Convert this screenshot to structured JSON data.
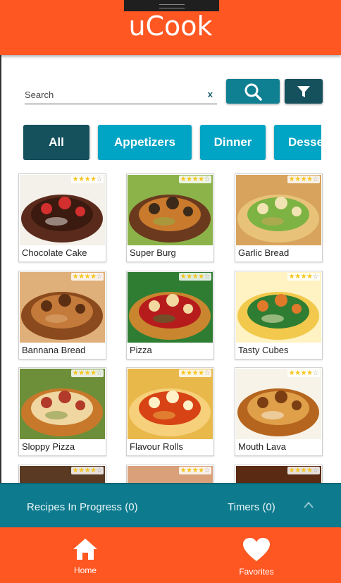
{
  "app": {
    "title": "uCook"
  },
  "search": {
    "placeholder": "Search",
    "value": "",
    "clear_label": "x"
  },
  "categories": [
    {
      "label": "All",
      "active": true
    },
    {
      "label": "Appetizers",
      "active": false
    },
    {
      "label": "Dinner",
      "active": false
    },
    {
      "label": "Desse",
      "active": false
    }
  ],
  "recipes": [
    {
      "name": "Chocolate Cake",
      "rating": 4,
      "icon": "chocolate-cake-photo"
    },
    {
      "name": "Super Burg",
      "rating": 4,
      "icon": "burger-photo"
    },
    {
      "name": "Garlic Bread",
      "rating": 4,
      "icon": "garlic-bread-photo"
    },
    {
      "name": "Bannana Bread",
      "rating": 4,
      "icon": "banana-bread-photo"
    },
    {
      "name": "Pizza",
      "rating": 4,
      "icon": "pizza-photo"
    },
    {
      "name": "Tasty Cubes",
      "rating": 4,
      "icon": "cubes-photo"
    },
    {
      "name": "Sloppy Pizza",
      "rating": 4,
      "icon": "calzone-photo"
    },
    {
      "name": "Flavour Rolls",
      "rating": 4,
      "icon": "rolls-photo"
    },
    {
      "name": "Mouth Lava",
      "rating": 4,
      "icon": "mozzarella-sticks-photo"
    },
    {
      "name": "",
      "rating": 4,
      "icon": "recipe-photo"
    },
    {
      "name": "",
      "rating": 4,
      "icon": "recipe-photo"
    },
    {
      "name": "",
      "rating": 4,
      "icon": "recipe-photo"
    }
  ],
  "progress": {
    "recipes_label": "Recipes In Progress (0)",
    "timers_label": "Timers (0)"
  },
  "nav": {
    "home_label": "Home",
    "favorites_label": "Favorites"
  },
  "colors": {
    "primary": "#ff5722",
    "teal": "#0e7a8d",
    "dark_teal": "#15505d",
    "cyan": "#00a4c4"
  }
}
